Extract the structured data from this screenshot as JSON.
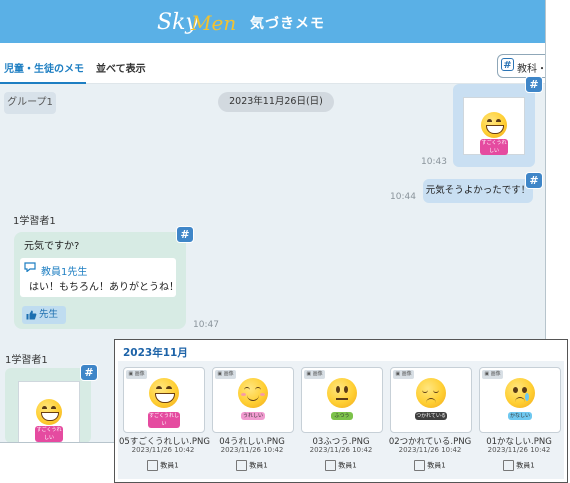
{
  "header": {
    "app_title": "気づきメモ",
    "logo_text": "SkyMenu"
  },
  "tabs": [
    {
      "label": "児童・生徒のメモ"
    },
    {
      "label": "並べて表示"
    }
  ],
  "subject_button": {
    "label": "教科・タ"
  },
  "chat": {
    "group_label": "グループ1",
    "date_label": "2023年11月26日(日)",
    "messages": [
      {
        "time": "10:43",
        "tag": "すごくうれしい"
      },
      {
        "text": "元気そうよかったです！",
        "time": "10:44"
      },
      {
        "sender": "1学習者1",
        "text": "元気ですか?",
        "reply_name": "教員1先生",
        "reply_text": "はい！もちろん！ありがとうね！",
        "like_label": "先生",
        "time": "10:47"
      },
      {
        "sender": "1学習者1",
        "tag": "すごくうれしい"
      }
    ]
  },
  "gallery": {
    "title": "2023年11月",
    "badge_label": "画像",
    "items": [
      {
        "tag": "すごくうれしい",
        "filename": "05すごくうれしい.PNG",
        "datetime": "2023/11/26 10:42",
        "owner": "教員1",
        "tag_color": "#e54ba0"
      },
      {
        "tag": "うれしい",
        "filename": "04うれしい.PNG",
        "datetime": "2023/11/26 10:42",
        "owner": "教員1",
        "tag_color": "#f19bd0"
      },
      {
        "tag": "ふつう",
        "filename": "03ふつう.PNG",
        "datetime": "2023/11/26 10:42",
        "owner": "教員1",
        "tag_color": "#7cc24a"
      },
      {
        "tag": "つかれている",
        "filename": "02つかれている.PNG",
        "datetime": "2023/11/26 10:42",
        "owner": "教員1",
        "tag_color": "#3f3f3f"
      },
      {
        "tag": "かなしい",
        "filename": "01かなしい.PNG",
        "datetime": "2023/11/26 10:42",
        "owner": "教員1",
        "tag_color": "#6ec8f0"
      }
    ]
  },
  "colors": {
    "accent": "#5ab0e6",
    "link": "#1d7ec2",
    "hash": "#3f86c8"
  }
}
